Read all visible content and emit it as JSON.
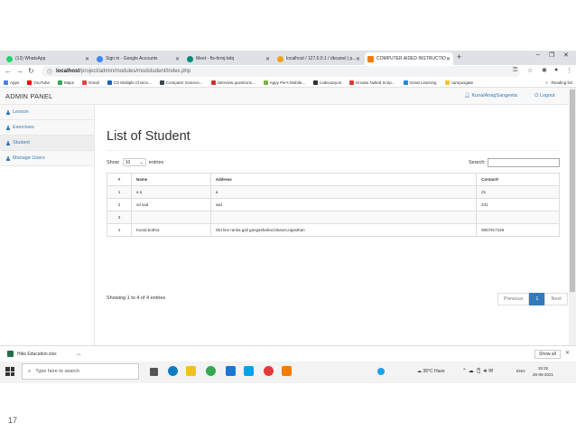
{
  "browser": {
    "tabs": [
      {
        "label": "(13) WhatsApp",
        "color": "#25d366"
      },
      {
        "label": "Sign in - Google Accounts",
        "color": "#4285f4"
      },
      {
        "label": "Meet - fts-hrmj-bdq",
        "color": "#00897b"
      },
      {
        "label": "localhost / 127.0.0.1 / dbcanel | p...",
        "color": "#f0a020"
      },
      {
        "label": "COMPUTER AIDED INSTRUCTIO",
        "color": "#f57c00"
      }
    ],
    "url_host": "localhost",
    "url_path": "/project/admin/modules/modstudent/index.php",
    "bookmarks": [
      {
        "label": "Apps",
        "color": "#4285f4"
      },
      {
        "label": "YouTube",
        "color": "#ff0000"
      },
      {
        "label": "Maps",
        "color": "#34a853"
      },
      {
        "label": "Gmail",
        "color": "#ea4335"
      },
      {
        "label": "CS Multiple Choice...",
        "color": "#1565c0"
      },
      {
        "label": "Computer Science...",
        "color": "#37474f"
      },
      {
        "label": "interview questions...",
        "color": "#d32f2f"
      },
      {
        "label": "Appy Pie's Mobile...",
        "color": "#7cb342"
      },
      {
        "label": "codecanyon",
        "color": "#333333"
      },
      {
        "label": "Envato Nulled Scrip...",
        "color": "#e53935"
      },
      {
        "label": "Great Learning",
        "color": "#1e88e5"
      },
      {
        "label": "campusgate",
        "color": "#fbc02d"
      }
    ],
    "bookmarks_more": "»",
    "reading_list": "Reading list"
  },
  "app": {
    "brand": "ADMIN PANEL",
    "user": "KunalAnagSangeeta",
    "logout": "Logout",
    "sidebar": [
      "Lesson",
      "Exercises",
      "Student",
      "Manage Users"
    ],
    "title": "List of Student",
    "show_label": "Show",
    "entries_value": "10",
    "entries_label": "entries",
    "search_label": "Search:",
    "table": {
      "headers": [
        "#",
        "Name",
        "Address",
        "Contact#"
      ],
      "rows": [
        [
          "1",
          "a a",
          "a",
          "21"
        ],
        [
          "2",
          "sd sad",
          "sad",
          "231"
        ],
        [
          "3",
          "",
          "",
          ""
        ],
        [
          "4",
          "Kunal bothra",
          "Old line ranka gali gangashahar,bikaner,rajasthan",
          "9057917159"
        ]
      ]
    },
    "info": "Showing 1 to 4 of 4 entries",
    "pagination": {
      "previous": "Previous",
      "current": "1",
      "next": "Next"
    }
  },
  "downloads": {
    "file": "Hike Education.xlsx",
    "show_all": "Show all"
  },
  "taskbar": {
    "search_placeholder": "Type here to search",
    "weather": "38°C  Haze",
    "lang": "ENG",
    "time": "15:32",
    "date": "26-06-2021"
  },
  "slide_number": "17"
}
